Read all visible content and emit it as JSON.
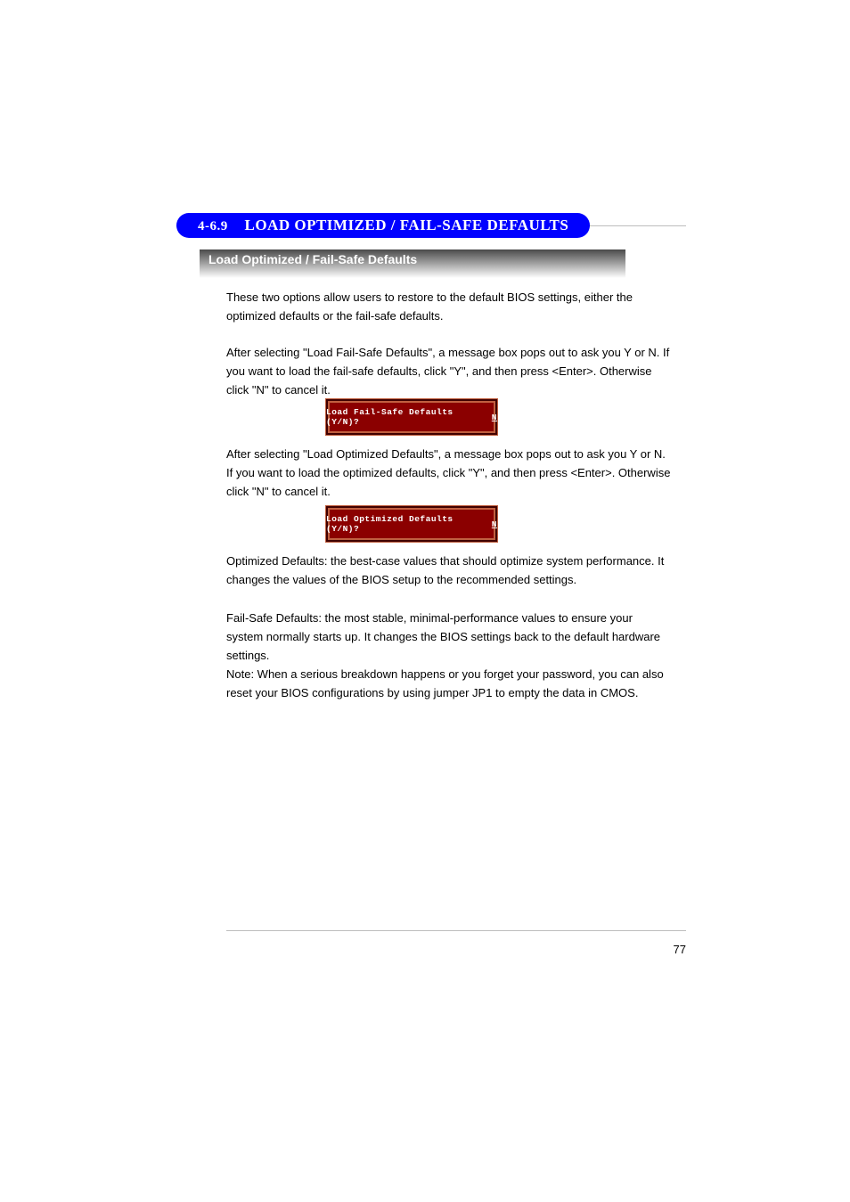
{
  "section": {
    "number": "4-6.9",
    "title": "LOAD OPTIMIZED / FAIL-SAFE DEFAULTS"
  },
  "gradient_title": "Load Optimized / Fail-Safe Defaults",
  "paragraphs": {
    "p1": "These two options allow users to restore to the default BIOS settings, either the optimized defaults or the fail-safe defaults.",
    "p2": "After selecting \"Load Fail-Safe Defaults\", a message box pops out to ask you Y or N. If you want to load the fail-safe defaults, click \"Y\", and then press <Enter>. Otherwise click \"N\" to cancel it.",
    "p3": "After selecting \"Load Optimized Defaults\", a message box pops out to ask you Y or N. If you want to load the optimized defaults, click \"Y\", and then press <Enter>. Otherwise click \"N\" to cancel it.",
    "p4": "Optimized Defaults: the best-case values that should optimize system performance. It changes the values of the BIOS setup to the recommended settings.",
    "p5": "Fail-Safe Defaults: the most stable, minimal-performance values to ensure your system normally starts up. It changes the BIOS settings back to the default hardware settings.",
    "p6": "Note: When a serious breakdown happens or you forget your password, you can also reset your BIOS configurations by using jumper JP1 to empty the data in CMOS."
  },
  "dialogs": {
    "d1": "Load Fail-Safe Defaults (Y/N)?",
    "d2": "Load Optimized Defaults (Y/N)?",
    "cursor": "N"
  },
  "footer": {
    "page_number": "77"
  }
}
